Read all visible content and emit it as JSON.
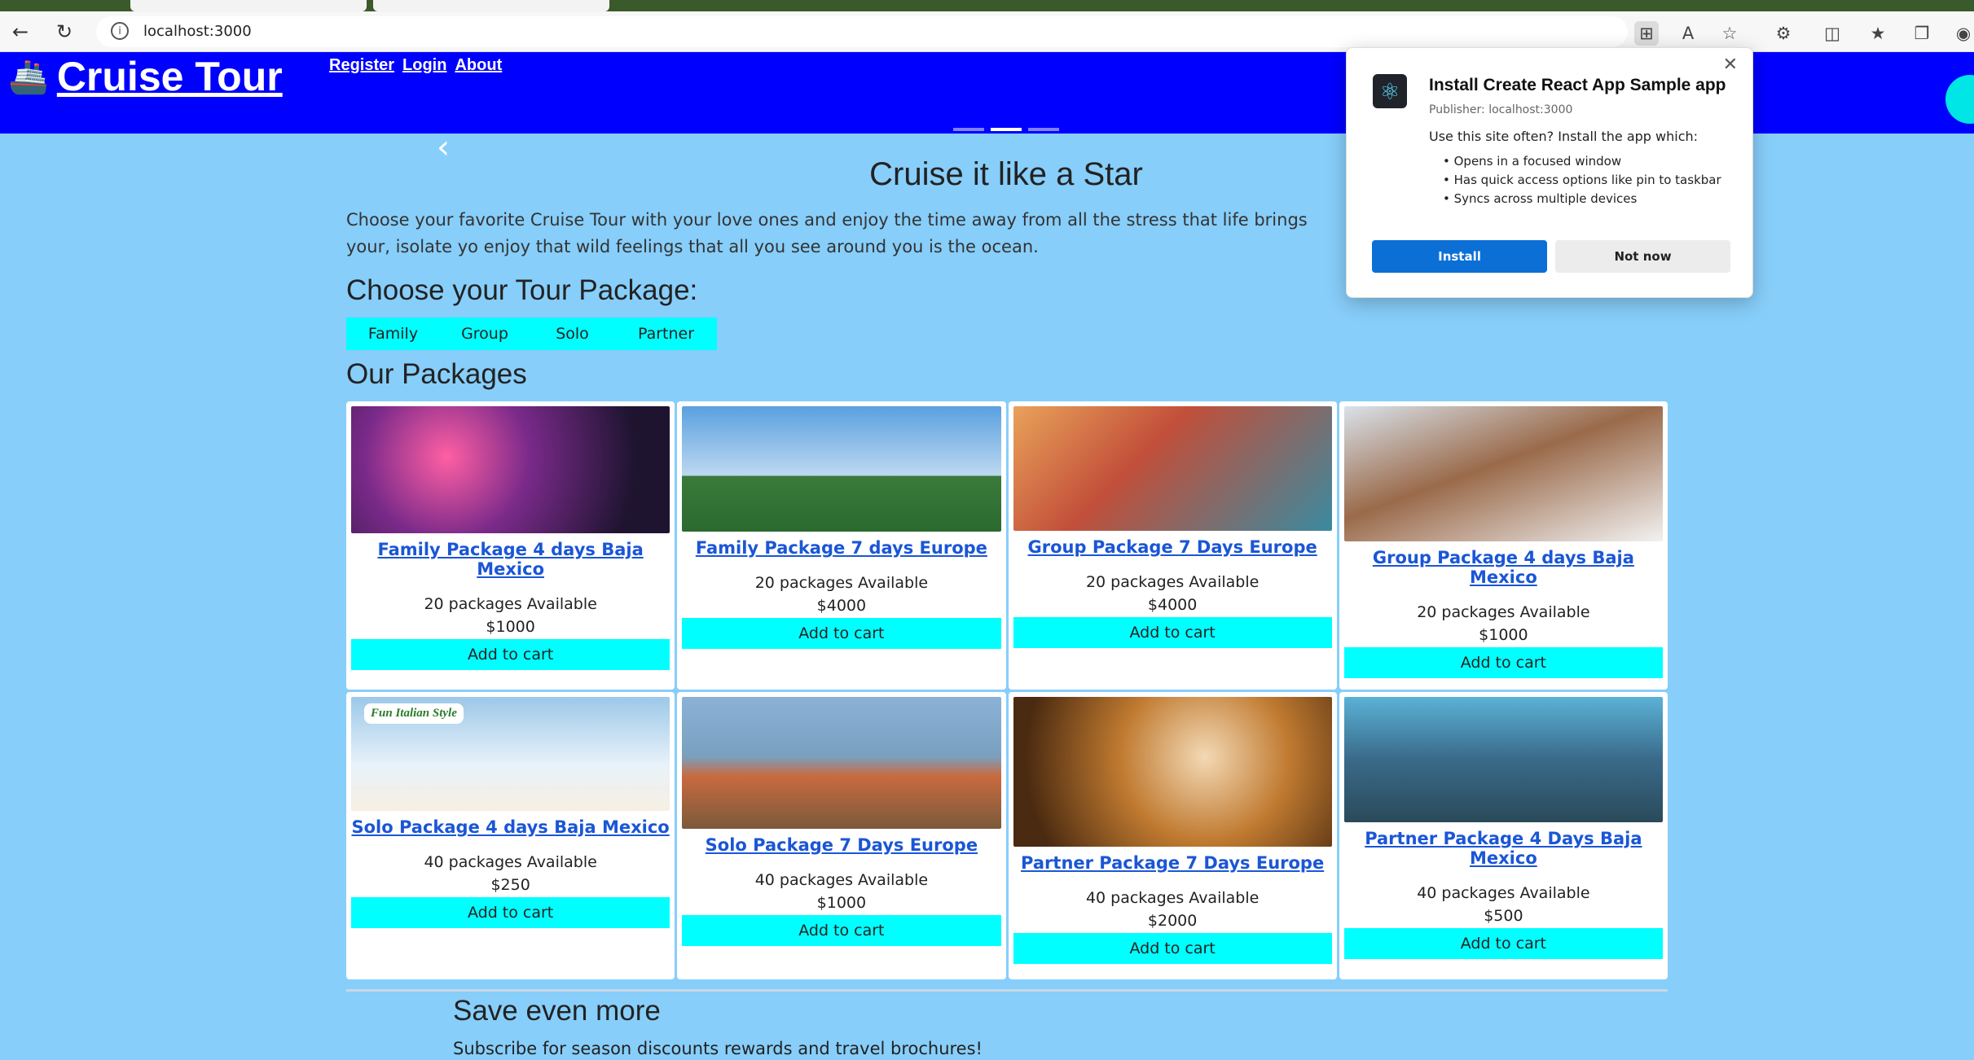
{
  "browser": {
    "url": "localhost:3000",
    "icons": [
      "back-icon",
      "reload-icon",
      "info-icon",
      "app-available-icon",
      "read-aloud-icon",
      "favorite-star-icon",
      "extensions-icon",
      "split-screen-icon",
      "favorites-icon",
      "collections-icon"
    ]
  },
  "header": {
    "brand": "Cruise Tour",
    "nav": [
      "Register",
      "Login",
      "About"
    ]
  },
  "hero": {
    "title": "Cruise it like a Star",
    "text": "Choose your favorite Cruise Tour with your love ones and enjoy the time away from all the stress that life brings your, isolate yo enjoy that wild feelings that all you see around you is the ocean."
  },
  "tour": {
    "heading": "Choose your Tour Package:",
    "filters": [
      "Family",
      "Group",
      "Solo",
      "Partner"
    ]
  },
  "packages": {
    "heading": "Our Packages",
    "items": [
      {
        "title": "Family Package 4 days Baja Mexico",
        "available": "20 packages Available",
        "price": "$1000",
        "button": "Add to cart"
      },
      {
        "title": "Family Package 7 days Europe",
        "available": "20 packages Available",
        "price": "$4000",
        "button": "Add to cart"
      },
      {
        "title": "Group Package 7 Days Europe",
        "available": "20 packages Available",
        "price": "$4000",
        "button": "Add to cart"
      },
      {
        "title": "Group Package 4 days Baja Mexico",
        "available": "20 packages Available",
        "price": "$1000",
        "button": "Add to cart"
      },
      {
        "title": "Solo Package 4 days Baja Mexico",
        "available": "40 packages Available",
        "price": "$250",
        "button": "Add to cart",
        "badge": "Fun Italian Style"
      },
      {
        "title": "Solo Package 7 Days Europe",
        "available": "40 packages Available",
        "price": "$1000",
        "button": "Add to cart"
      },
      {
        "title": "Partner Package 7 Days Europe",
        "available": "40 packages Available",
        "price": "$2000",
        "button": "Add to cart"
      },
      {
        "title": "Partner Package 4 Days Baja Mexico",
        "available": "40 packages Available",
        "price": "$500",
        "button": "Add to cart"
      }
    ]
  },
  "save": {
    "title": "Save even more",
    "subtitle": "Subscribe for season discounts rewards and travel brochures!"
  },
  "popup": {
    "title": "Install Create React App Sample app",
    "publisher": "Publisher: localhost:3000",
    "question": "Use this site often? Install the app which:",
    "features": [
      "Opens in a focused window",
      "Has quick access options like pin to taskbar",
      "Syncs across multiple devices"
    ],
    "install": "Install",
    "not_now": "Not now"
  }
}
